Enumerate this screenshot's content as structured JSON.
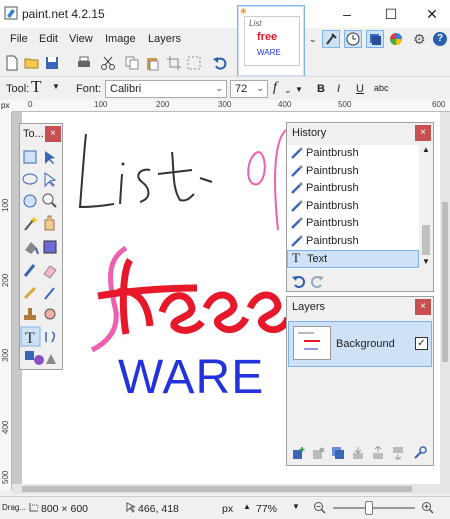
{
  "app": {
    "title": "paint.net 4.2.15"
  },
  "window_controls": {
    "minimize": "–",
    "maximize": "☐",
    "close": "✕"
  },
  "menu": [
    "File",
    "Edit",
    "View",
    "Image",
    "Layers"
  ],
  "thumbnail": {
    "line1": "List",
    "line2": "free",
    "line3": "WARE"
  },
  "toolbar": {
    "tool_label": "Tool:",
    "tool_glyph": "T",
    "font_label": "Font:",
    "font_value": "Calibri",
    "size_value": "72",
    "fx_glyph": "f",
    "bold": "B",
    "italic": "I",
    "underline": "U",
    "strike": "abc"
  },
  "ruler": {
    "unit": "px",
    "top_ticks": [
      "0",
      "100",
      "200",
      "300",
      "400",
      "500",
      "600"
    ],
    "left_ticks": [
      "100",
      "200",
      "300",
      "400",
      "500"
    ]
  },
  "canvas": {
    "text_line1": "List of",
    "text_line2": "free",
    "text_line3": "WARE",
    "colors": {
      "black": "#333333",
      "pink": "#ef5fb0",
      "red": "#e8182b",
      "blue": "#2233dd"
    }
  },
  "tools_panel": {
    "title": "To..."
  },
  "history": {
    "title": "History",
    "items": [
      {
        "label": "Paintbrush",
        "icon": "paintbrush-icon",
        "selected": false
      },
      {
        "label": "Paintbrush",
        "icon": "paintbrush-icon",
        "selected": false
      },
      {
        "label": "Paintbrush",
        "icon": "paintbrush-icon",
        "selected": false
      },
      {
        "label": "Paintbrush",
        "icon": "paintbrush-icon",
        "selected": false
      },
      {
        "label": "Paintbrush",
        "icon": "paintbrush-icon",
        "selected": false
      },
      {
        "label": "Paintbrush",
        "icon": "paintbrush-icon",
        "selected": false
      },
      {
        "label": "Text",
        "icon": "text-icon",
        "selected": true
      }
    ]
  },
  "layers": {
    "title": "Layers",
    "items": [
      {
        "name": "Background",
        "visible": true
      }
    ]
  },
  "status": {
    "hint": "Drag...",
    "image_size": "800 × 600",
    "cursor": "466, 418",
    "unit": "px",
    "zoom": "77%"
  }
}
